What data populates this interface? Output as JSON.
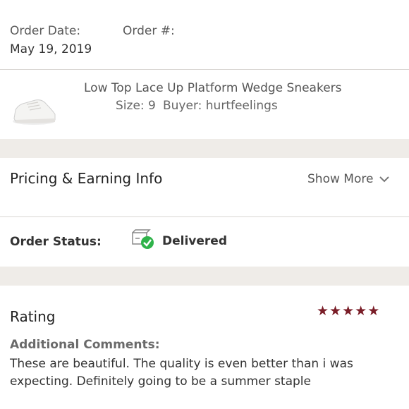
{
  "order": {
    "date_label": "Order Date:",
    "date_value": "May 19, 2019",
    "number_label": "Order #:"
  },
  "item": {
    "title": "Low Top Lace Up Platform Wedge Sneakers",
    "size_label": "Size: 9",
    "buyer_label": "Buyer: hurtfeelings"
  },
  "pricing": {
    "title": "Pricing & Earning Info",
    "show_more_label": "Show More"
  },
  "status": {
    "label": "Order Status:",
    "value": "Delivered",
    "status_color": "#2fb34a"
  },
  "rating": {
    "title": "Rating",
    "stars": 5,
    "star_color": "#7a1e28",
    "comments_label": "Additional Comments:",
    "comments_text": "These are beautiful. The quality is even better than i was expecting. Definitely going to be a summer staple"
  },
  "icons": {
    "status": "delivered-box-check-icon",
    "show_more": "chevron-down-icon",
    "star": "star-icon"
  }
}
